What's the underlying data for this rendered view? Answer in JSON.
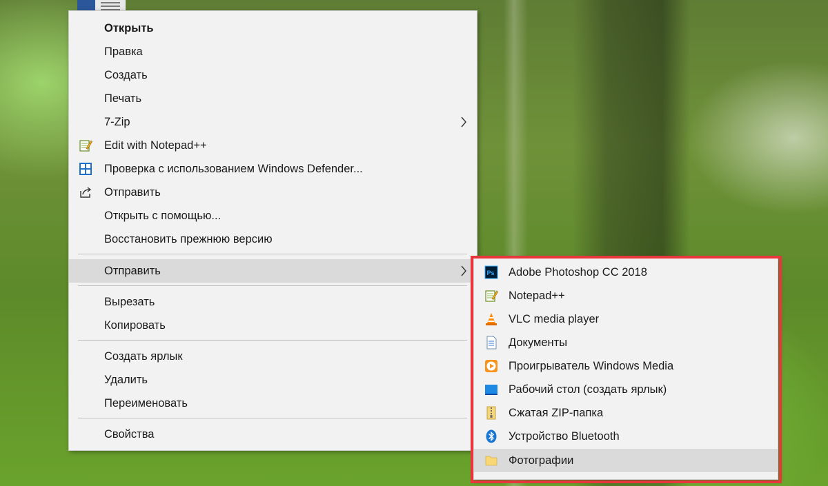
{
  "main_menu": {
    "items": [
      {
        "label": "Открыть",
        "bold": true
      },
      {
        "label": "Правка"
      },
      {
        "label": "Создать"
      },
      {
        "label": "Печать"
      },
      {
        "label": "7-Zip",
        "submenu": true
      },
      {
        "label": "Edit with Notepad++",
        "icon": "notepadpp-icon"
      },
      {
        "label": "Проверка с использованием Windows Defender...",
        "icon": "windows-defender-icon"
      },
      {
        "label": "Отправить",
        "icon": "share-icon"
      },
      {
        "label": "Открыть с помощью..."
      },
      {
        "label": "Восстановить прежнюю версию"
      },
      {
        "label": "Отправить",
        "submenu": true,
        "selected": true
      },
      {
        "label": "Вырезать"
      },
      {
        "label": "Копировать"
      },
      {
        "label": "Создать ярлык"
      },
      {
        "label": "Удалить"
      },
      {
        "label": "Переименовать"
      },
      {
        "label": "Свойства"
      }
    ]
  },
  "send_to_menu": {
    "items": [
      {
        "label": "Adobe Photoshop CC 2018",
        "icon": "photoshop-icon"
      },
      {
        "label": "Notepad++",
        "icon": "notepadpp-icon"
      },
      {
        "label": "VLC media player",
        "icon": "vlc-cone-icon"
      },
      {
        "label": "Документы",
        "icon": "documents-icon"
      },
      {
        "label": "Проигрыватель Windows Media",
        "icon": "media-player-icon"
      },
      {
        "label": "Рабочий стол (создать ярлык)",
        "icon": "desktop-icon"
      },
      {
        "label": "Сжатая ZIP-папка",
        "icon": "zip-folder-icon"
      },
      {
        "label": "Устройство Bluetooth",
        "icon": "bluetooth-icon"
      },
      {
        "label": "Фотографии",
        "icon": "folder-icon",
        "selected": true
      }
    ],
    "frame_color": "#e8363c"
  },
  "colors": {
    "menu_bg": "#f2f2f2",
    "selected_bg": "#dadada",
    "separator": "#bdbdbd"
  }
}
